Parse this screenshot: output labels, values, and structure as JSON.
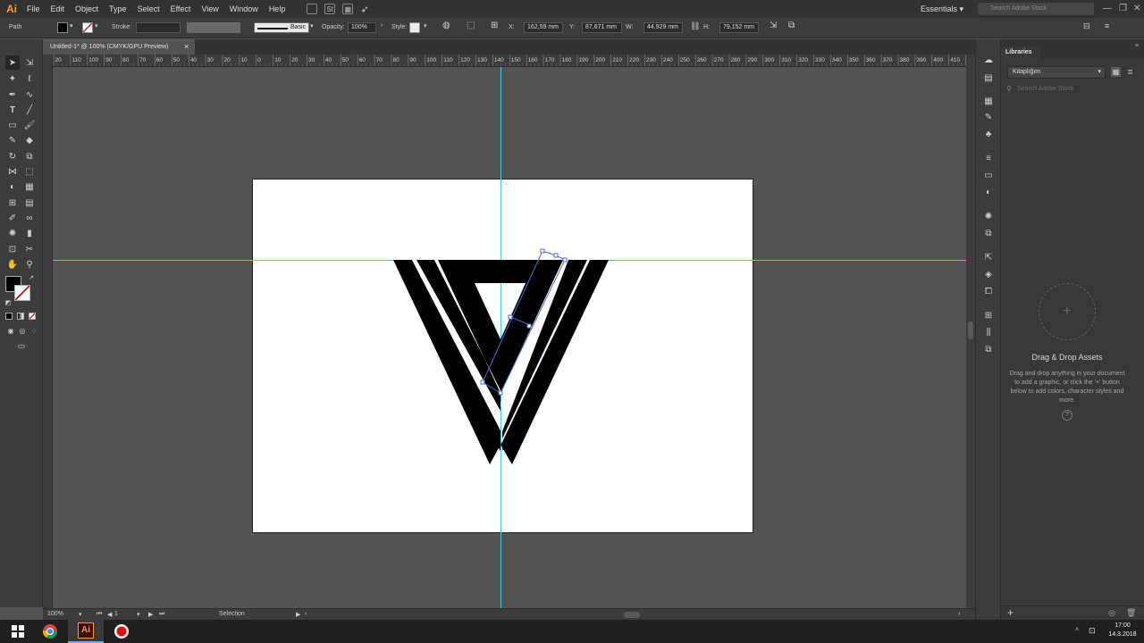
{
  "app": {
    "logo": "Ai"
  },
  "menu": [
    "File",
    "Edit",
    "Object",
    "Type",
    "Select",
    "Effect",
    "View",
    "Window",
    "Help"
  ],
  "menubar": {
    "st_icon": "St",
    "workspace": "Essentials",
    "stock_search_placeholder": "Search Adobe Stock"
  },
  "control": {
    "selection_type": "Path",
    "stroke_label": "Stroke:",
    "brush_label": "Basic",
    "opacity_label": "Opacity:",
    "opacity_value": "100%",
    "style_label": "Style:",
    "x_label": "X:",
    "x_value": "162,59 mm",
    "y_label": "Y:",
    "y_value": "87,671 mm",
    "w_label": "W:",
    "w_value": "44,929 mm",
    "h_label": "H:",
    "h_value": "79,152 mm"
  },
  "document": {
    "tab_title": "Untitled-1* @ 100% (CMYK/GPU Preview)",
    "close": "×"
  },
  "ruler": {
    "top_ticks": [
      "20",
      "110",
      "100",
      "90",
      "80",
      "70",
      "60",
      "50",
      "40",
      "30",
      "20",
      "10",
      "0",
      "10",
      "20",
      "30",
      "40",
      "50",
      "60",
      "70",
      "80",
      "90",
      "100",
      "110",
      "120",
      "130",
      "140",
      "150",
      "160",
      "170",
      "180",
      "190",
      "200",
      "210",
      "220",
      "230",
      "240",
      "250",
      "260",
      "270",
      "280",
      "290",
      "300",
      "310",
      "320",
      "330",
      "340",
      "350",
      "360",
      "370",
      "380",
      "390",
      "400",
      "410",
      "4"
    ]
  },
  "status": {
    "zoom": "100%",
    "artboard_num": "1",
    "tool_name": "Selection"
  },
  "libraries": {
    "tab_label": "Libraries",
    "library_name": "Kitaplığım",
    "search_placeholder": "Search Adobe Stock",
    "plus": "+",
    "dd_title": "Drag & Drop Assets",
    "dd_body": "Drag and drop anything in your document to add a graphic, or click the '+' button below to add colors, character styles and more.",
    "help": "?",
    "add": "+"
  },
  "taskbar": {
    "ai_label": "Ai",
    "time": "17:00",
    "date": "14.3.2018"
  },
  "colors": {
    "guide": "#4fc3e8",
    "selection": "#4a6cd4",
    "ai_orange": "#f29b38",
    "ai_bg": "#3b0d03"
  }
}
